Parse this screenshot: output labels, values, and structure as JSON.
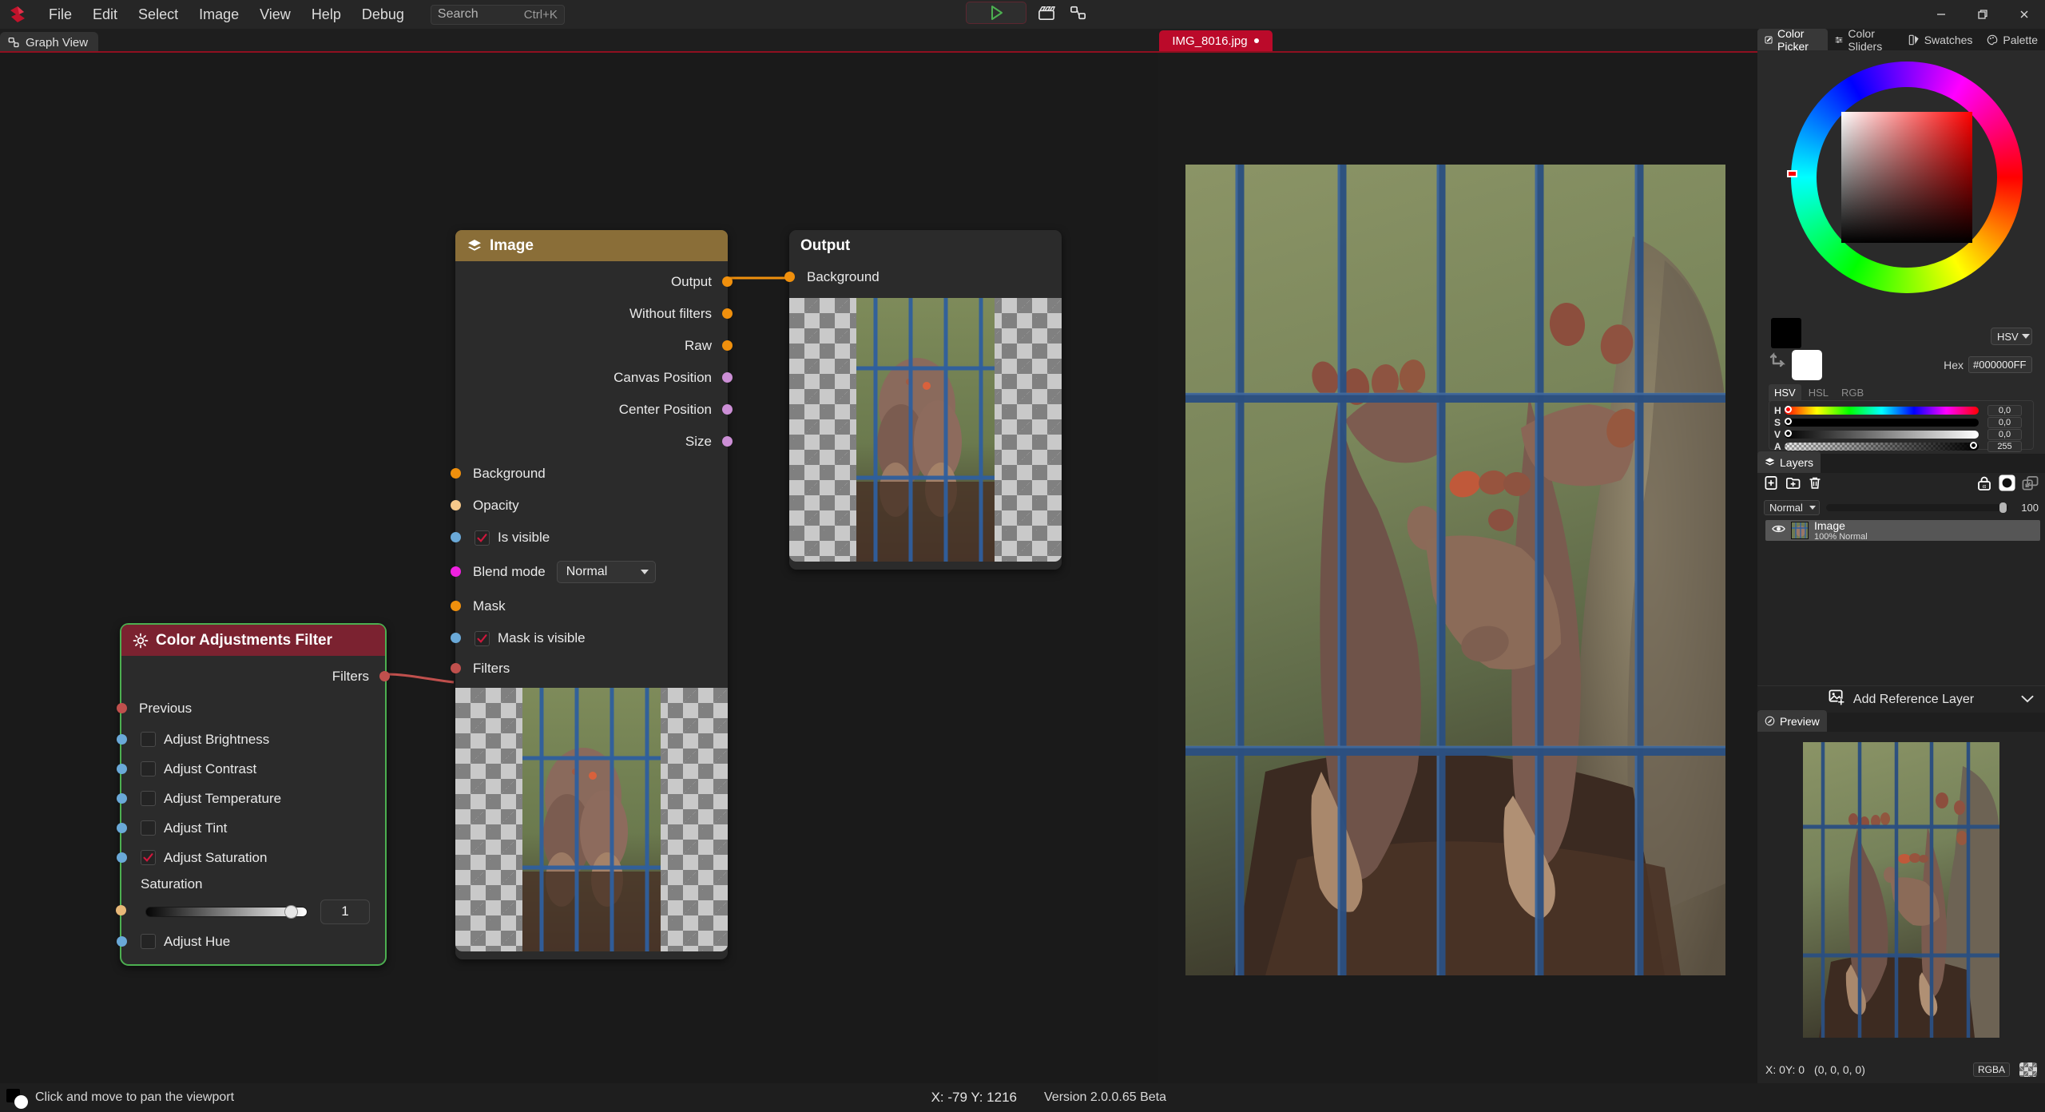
{
  "app": {
    "logo_icon": "app-logo-icon",
    "version": "Version 2.0.0.65 Beta"
  },
  "menubar": {
    "items": [
      "File",
      "Edit",
      "Select",
      "Image",
      "View",
      "Help",
      "Debug"
    ],
    "search": {
      "placeholder": "Search",
      "shortcut": "Ctrl+K"
    },
    "tools": [
      {
        "name": "run-button",
        "icon": "play-icon"
      },
      {
        "name": "animation-button",
        "icon": "clapperboard-icon"
      },
      {
        "name": "node-graph-button",
        "icon": "node-graph-icon"
      }
    ],
    "window_controls": [
      {
        "name": "minimize-button",
        "glyph": "—"
      },
      {
        "name": "restore-button",
        "glyph": "❐"
      },
      {
        "name": "close-button",
        "glyph": "✕"
      }
    ]
  },
  "viewtabs": {
    "graph_view": {
      "label": "Graph View",
      "icon": "node-graph-icon"
    },
    "document": {
      "label": "IMG_8016.jpg",
      "modified": true
    }
  },
  "graph": {
    "nodes": [
      {
        "id": "color-adjustments-filter",
        "title": "Color Adjustments Filter",
        "icon": "brightness-icon",
        "header_color": "#7b2230",
        "selected": true,
        "selection_color": "#4caf50",
        "outputs": [
          {
            "label": "Filters",
            "color": "#c0504d"
          }
        ],
        "inputs": [
          {
            "label": "Previous",
            "color": "#c0504d",
            "kind": "port"
          },
          {
            "label": "Adjust Brightness",
            "color": "#6aa9d8",
            "kind": "checkbox",
            "checked": false
          },
          {
            "label": "Adjust Contrast",
            "color": "#6aa9d8",
            "kind": "checkbox",
            "checked": false
          },
          {
            "label": "Adjust Temperature",
            "color": "#6aa9d8",
            "kind": "checkbox",
            "checked": false
          },
          {
            "label": "Adjust Tint",
            "color": "#6aa9d8",
            "kind": "checkbox",
            "checked": false
          },
          {
            "label": "Adjust Saturation",
            "color": "#6aa9d8",
            "kind": "checkbox",
            "checked": true
          }
        ],
        "slider": {
          "label": "Saturation",
          "value": "1",
          "percent": 86,
          "color": "#e8b878"
        },
        "trailing_inputs": [
          {
            "label": "Adjust Hue",
            "color": "#6aa9d8",
            "kind": "checkbox",
            "checked": false
          }
        ]
      },
      {
        "id": "image-node",
        "title": "Image",
        "icon": "layers-icon",
        "header_color": "#8a6e38",
        "selected": false,
        "outputs": [
          {
            "label": "Output",
            "color": "#f0900d"
          },
          {
            "label": "Without filters",
            "color": "#f0900d"
          },
          {
            "label": "Raw",
            "color": "#f0900d"
          },
          {
            "label": "Canvas Position",
            "color": "#cc8fd6"
          },
          {
            "label": "Center Position",
            "color": "#cc8fd6"
          },
          {
            "label": "Size",
            "color": "#cc8fd6"
          }
        ],
        "inputs": [
          {
            "label": "Background",
            "color": "#f0900d",
            "kind": "port"
          },
          {
            "label": "Opacity",
            "color": "#f7c98a",
            "kind": "port"
          },
          {
            "label": "Is visible",
            "color": "#6aa9d8",
            "kind": "checkbox",
            "checked": true
          },
          {
            "label": "Blend mode",
            "color": "#ef21e0",
            "kind": "combo",
            "value": "Normal"
          },
          {
            "label": "Mask",
            "color": "#f0900d",
            "kind": "port"
          },
          {
            "label": "Mask is visible",
            "color": "#6aa9d8",
            "kind": "checkbox",
            "checked": true
          },
          {
            "label": "Filters",
            "color": "#c0504d",
            "kind": "port"
          }
        ]
      },
      {
        "id": "output-node",
        "title": "Output",
        "icon": "",
        "header_color": "transparent",
        "selected": false,
        "outputs": [],
        "inputs": [
          {
            "label": "Background",
            "color": "#f0900d",
            "kind": "port"
          }
        ]
      }
    ],
    "connections": [
      {
        "from": "image-node.Output",
        "to": "output-node.Background",
        "color": "#f0900d"
      },
      {
        "from": "color-adjustments-filter.Filters",
        "to": "image-node.Filters",
        "color": "#c0504d"
      }
    ]
  },
  "colorpanel": {
    "tabs": [
      {
        "label": "Color Picker",
        "icon": "color-picker-icon",
        "active": true
      },
      {
        "label": "Color Sliders",
        "icon": "sliders-icon",
        "active": false
      },
      {
        "label": "Swatches",
        "icon": "swatches-icon",
        "active": false
      },
      {
        "label": "Palette",
        "icon": "palette-icon",
        "active": false
      }
    ],
    "mode": "HSV",
    "hex_label": "Hex",
    "hex_value": "#000000FF",
    "model_tabs": [
      "HSV",
      "HSL",
      "RGB"
    ],
    "model_active": "HSV",
    "channels": [
      {
        "name": "H",
        "value": "0,0",
        "pos": 0
      },
      {
        "name": "S",
        "value": "0,0",
        "pos": 0
      },
      {
        "name": "V",
        "value": "0,0",
        "pos": 0
      },
      {
        "name": "A",
        "value": "255",
        "pos": 100
      }
    ],
    "foreground": "#000000",
    "background": "#FFFFFF"
  },
  "layerspanel": {
    "tab": {
      "label": "Layers",
      "icon": "layers-icon"
    },
    "tools": [
      {
        "name": "new-layer-button",
        "icon": "new-layer-icon"
      },
      {
        "name": "new-group-button",
        "icon": "new-folder-icon"
      },
      {
        "name": "delete-layer-button",
        "icon": "trash-icon"
      },
      {
        "name": "alpha-lock-button",
        "icon": "alpha-lock-icon"
      },
      {
        "name": "mask-button",
        "icon": "mask-circle-icon"
      },
      {
        "name": "merge-button",
        "icon": "merge-icon"
      }
    ],
    "blend_mode": "Normal",
    "opacity": "100",
    "layers": [
      {
        "name": "Image",
        "sub": "100%  Normal",
        "visible": true
      }
    ]
  },
  "reference": {
    "label": "Add Reference Layer",
    "icon": "add-image-icon",
    "chevron": "chevron-down-icon"
  },
  "preview": {
    "tab": {
      "label": "Preview",
      "icon": "preview-icon"
    },
    "cursor": "X: 0Y: 0",
    "pixel": "(0, 0, 0, 0)",
    "colorspace": "RGBA"
  },
  "statusbar": {
    "message": "Click and move to pan the viewport",
    "coords": "X: -79 Y: 1216",
    "version": "Version 2.0.0.65 Beta"
  }
}
